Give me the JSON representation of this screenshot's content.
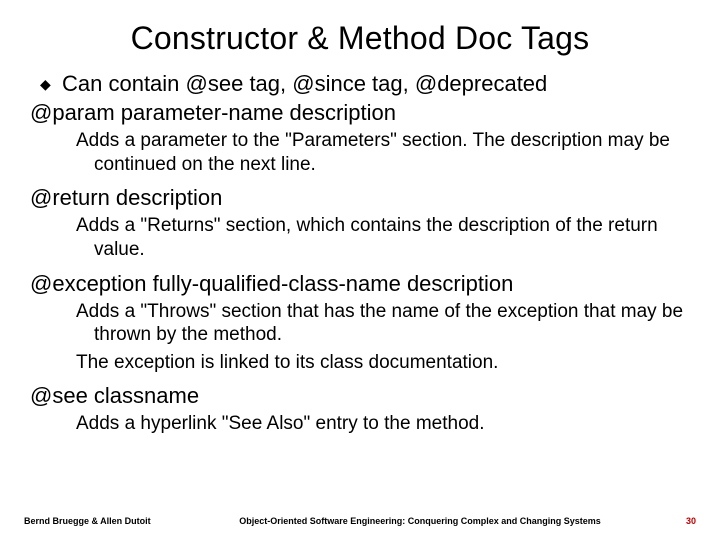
{
  "title": "Constructor & Method Doc Tags",
  "bullet1": "Can contain @see tag, @since tag, @deprecated",
  "tags": {
    "param": {
      "sig": "@param parameter-name description",
      "desc": "Adds a parameter to the \"Parameters\" section. The description may be continued on the next line."
    },
    "ret": {
      "sig": "@return description",
      "desc": "Adds a \"Returns\" section, which contains the description of the return value."
    },
    "exc": {
      "sig": "@exception fully-qualified-class-name description",
      "desc1": "Adds a \"Throws\" section that has the name of the exception that may be thrown by the method.",
      "desc2": "The exception is linked to its class documentation."
    },
    "see": {
      "sig": "@see classname",
      "desc": "Adds a hyperlink \"See Also\" entry to the method."
    }
  },
  "footer": {
    "left": "Bernd Bruegge & Allen Dutoit",
    "mid": "Object-Oriented Software Engineering: Conquering Complex and Changing Systems",
    "page": "30"
  }
}
